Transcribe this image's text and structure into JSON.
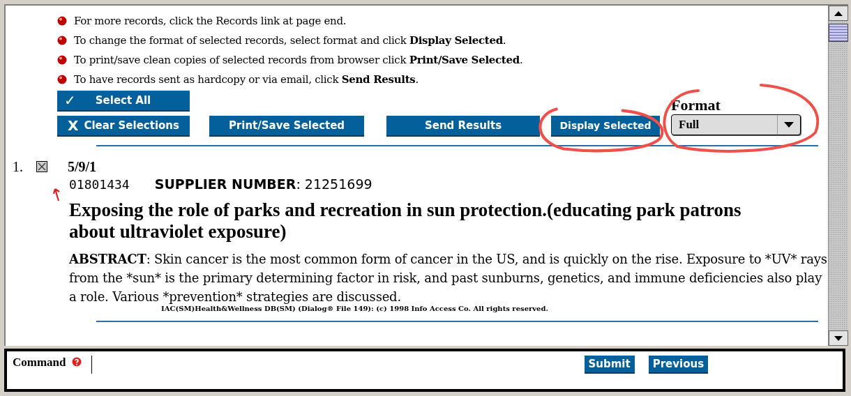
{
  "instructions": [
    {
      "text": "For more records, click the Records link at page end."
    },
    {
      "text": "To change the format of selected records, select format and click **Display Selected**."
    },
    {
      "text": "To print/save clean copies of selected records from browser click **Print/Save Selected**."
    },
    {
      "text": "To have records sent as hardcopy or via email, click **Send Results**."
    }
  ],
  "select_all": {
    "label": "Select All",
    "glyph": "✓"
  },
  "buttons": [
    {
      "label": "Clear Selections",
      "glyph": "X"
    },
    {
      "label": "Print/Save Selected"
    },
    {
      "label": "Send Results"
    },
    {
      "label": "Display Selected"
    }
  ],
  "format": {
    "label": "Format",
    "value": "Full"
  },
  "record": {
    "number": "1.",
    "checked": true,
    "id": "5/9/1",
    "accession": "01801434",
    "supplier": "**SUPPLIER NUMBER**: 21251699",
    "title": "Exposing the role of parks and recreation in sun protection.(educating park patrons about ultraviolet exposure)",
    "abstract_label": "ABSTRACT",
    "abstract": ": Skin cancer is the most common form of cancer in the US, and is quickly on the rise. Exposure to *UV* rays from the *sun* is the primary determining factor in risk, and past sunburns, genetics, and immune deficiencies also play a role. Various *prevention* strategies are discussed.",
    "source": "IAC(SM)Health&Wellness DB(SM) (Dialog® File 149): (c) 1998 Info Access Co. All rights reserved."
  },
  "command": {
    "label": "Command",
    "buttons": [
      "Submit",
      "Previous"
    ]
  }
}
